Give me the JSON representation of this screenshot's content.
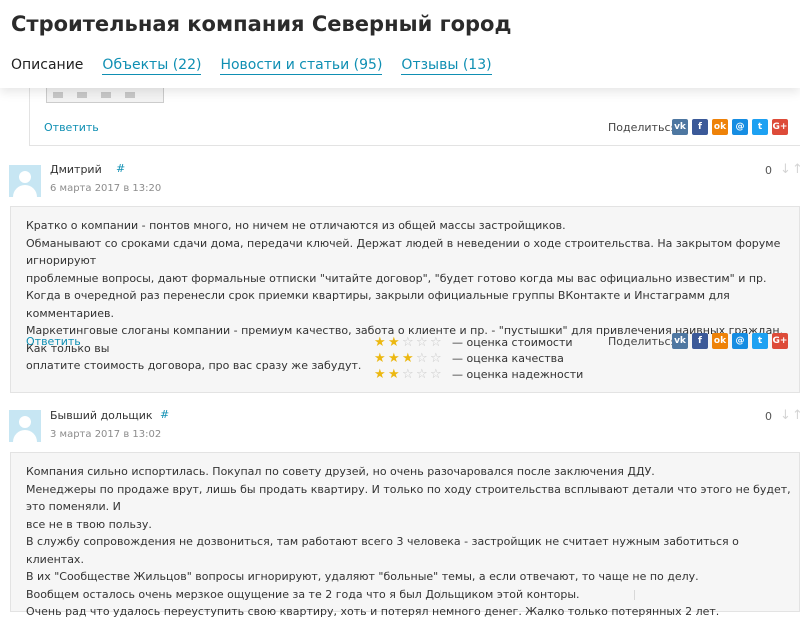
{
  "page": {
    "title": "Строительная компания Северный город",
    "tabs": [
      {
        "label": "Описание",
        "active": true
      },
      {
        "label": "Объекты (22)",
        "active": false
      },
      {
        "label": "Новости и статьи (95)",
        "active": false
      },
      {
        "label": "Отзывы (13)",
        "active": false
      }
    ]
  },
  "common": {
    "reply_label": "Ответить",
    "share_label": "Поделиться",
    "share_buttons": [
      {
        "icon": "vk-icon",
        "glyph": "vk",
        "color": "#4e77a1"
      },
      {
        "icon": "facebook-icon",
        "glyph": "f",
        "color": "#3b5998"
      },
      {
        "icon": "odnoklassniki-icon",
        "glyph": "ok",
        "color": "#ee8208"
      },
      {
        "icon": "mailru-icon",
        "glyph": "@",
        "color": "#168de2"
      },
      {
        "icon": "twitter-icon",
        "glyph": "t",
        "color": "#1da1f2"
      },
      {
        "icon": "google-plus-icon",
        "glyph": "G+",
        "color": "#dd4b39"
      }
    ],
    "accent_color": "#0f8fb3",
    "star_color": "#ecb811"
  },
  "comments": [
    {
      "author": "Дмитрий",
      "hash": "#",
      "date": "6 марта 2017 в 13:20",
      "votes": "0",
      "lines": [
        "Кратко о компании - понтов много, но ничем не отличаются из общей массы застройщиков.",
        "Обманывают со сроками сдачи дома, передачи ключей. Держат людей в неведении о ходе строительства. На закрытом форуме игнорируют",
        "проблемные вопросы, дают формальные отписки \"читайте договор\", \"будет готово когда мы вас официально известим\" и пр.",
        "Когда в очередной раз перенесли срок приемки квартиры, закрыли официальные группы ВКонтакте и Инстаграмм для комментариев.",
        "Маркетинговые слоганы компании - премиум качество, забота о клиенте и пр. - \"пустышки\" для привлечения наивных граждан. Как только вы",
        "оплатите стоимость договора, про вас сразу же забудут."
      ],
      "ratings": [
        {
          "label": "— оценка стоимости",
          "stars": 2,
          "max": 5
        },
        {
          "label": "— оценка качества",
          "stars": 3,
          "max": 5
        },
        {
          "label": "— оценка надежности",
          "stars": 2,
          "max": 5
        }
      ]
    },
    {
      "author": "Бывший дольщик",
      "hash": "#",
      "date": "3 марта 2017 в 13:02",
      "votes": "0",
      "lines": [
        "Компания сильно испортилась. Покупал по совету друзей, но очень разочаровался после заключения ДДУ.",
        "Менеджеры по продаже врут, лишь бы продать квартиру. И только по ходу строительства всплывают детали что этого не будет, это поменяли. И",
        "все не в твою пользу.",
        "В службу сопровождения не дозвониться, там работают всего 3 человека - застройщик не считает нужным заботиться о клиентах.",
        "В их \"Сообществе Жильцов\" вопросы игнорируют, удаляют \"больные\" темы, а если отвечают, то чаще не по делу.",
        "Вообщем осталось очень мерзкое ощущение за те 2 года что я был Дольщиком этой конторы.",
        "Очень рад что удалось переуступить свою квартиру, хоть и потерял немного денег. Жалко только потерянных 2 лет."
      ]
    }
  ]
}
